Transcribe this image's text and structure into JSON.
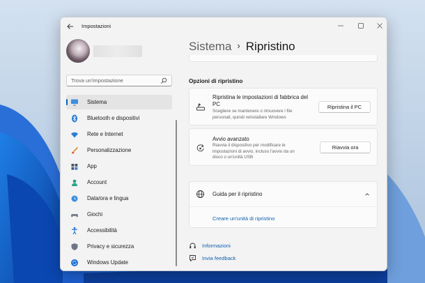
{
  "window": {
    "title": "Impostazioni"
  },
  "search": {
    "placeholder": "Trova un'impostazione"
  },
  "sidebar": {
    "items": [
      {
        "label": "Sistema",
        "icon": "monitor-icon",
        "active": true
      },
      {
        "label": "Bluetooth e dispositivi",
        "icon": "bluetooth-icon"
      },
      {
        "label": "Rete e Internet",
        "icon": "wifi-icon"
      },
      {
        "label": "Personalizzazione",
        "icon": "brush-icon"
      },
      {
        "label": "App",
        "icon": "apps-icon"
      },
      {
        "label": "Account",
        "icon": "person-icon"
      },
      {
        "label": "Data/ora e lingua",
        "icon": "globe-clock-icon"
      },
      {
        "label": "Giochi",
        "icon": "gamepad-icon"
      },
      {
        "label": "Accessibilità",
        "icon": "accessibility-icon"
      },
      {
        "label": "Privacy e sicurezza",
        "icon": "shield-icon"
      },
      {
        "label": "Windows Update",
        "icon": "update-icon"
      }
    ]
  },
  "breadcrumb": {
    "parent": "Sistema",
    "separator": "›",
    "current": "Ripristino"
  },
  "main": {
    "section_title": "Opzioni di ripristino",
    "reset_card": {
      "title_line1": "Ripristina le impostazioni di fabbrica del",
      "title_line2": "PC",
      "desc_line1": "Scegliere se mantenere o rimuovere i file",
      "desc_line2": "personali, quindi reinstallare Windows",
      "button": "Ripristina il PC"
    },
    "advanced_card": {
      "title": "Avvio avanzato",
      "desc_line1": "Riavvia il dispositivo per modificare le",
      "desc_line2": "impostazioni di avvio, incluso l'avvio da un",
      "desc_line3": "disco o un'unità USB",
      "button": "Riavvia ora"
    },
    "help_card": {
      "title": "Guida per il ripristino",
      "link": "Creare un'unità di ripristino"
    },
    "footer": {
      "info": "Informazioni",
      "feedback": "Invia feedback"
    }
  },
  "colors": {
    "accent": "#0067c0",
    "link": "#0f5fab",
    "window_bg": "#f3f3f3"
  }
}
